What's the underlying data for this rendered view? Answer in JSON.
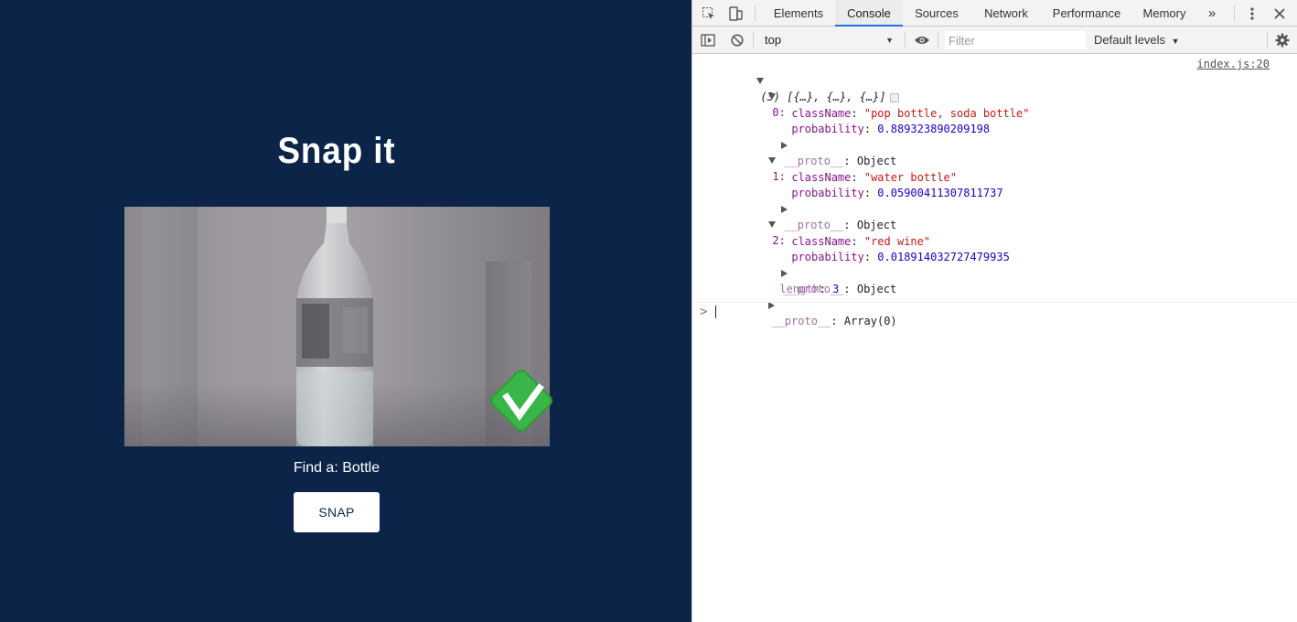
{
  "app": {
    "title": "Snap it",
    "find_label": "Find a: Bottle",
    "snap_button": "SNAP",
    "background": "#0b2447"
  },
  "devtools": {
    "tabs": [
      "Elements",
      "Console",
      "Sources",
      "Network",
      "Performance",
      "Memory"
    ],
    "active_tab": "Console",
    "more_tabs": "»",
    "context": "top",
    "filter_placeholder": "Filter",
    "levels": "Default levels",
    "console": {
      "source_link": "index.js:20",
      "summary": "(3) [{…}, {…}, {…}]",
      "items": [
        {
          "index": "0:",
          "className": "\"pop bottle, soda bottle\"",
          "probability": "0.889323890209198"
        },
        {
          "index": "1:",
          "className": "\"water bottle\"",
          "probability": "0.05900411307811737"
        },
        {
          "index": "2:",
          "className": "\"red wine\"",
          "probability": "0.018914032727479935"
        }
      ],
      "classname_key": "className",
      "probability_key": "probability",
      "proto_key": "__proto__",
      "proto_object": "Object",
      "length_key": "length",
      "length_value": "3",
      "array_proto": "Array(0)",
      "prompt": ">"
    }
  }
}
